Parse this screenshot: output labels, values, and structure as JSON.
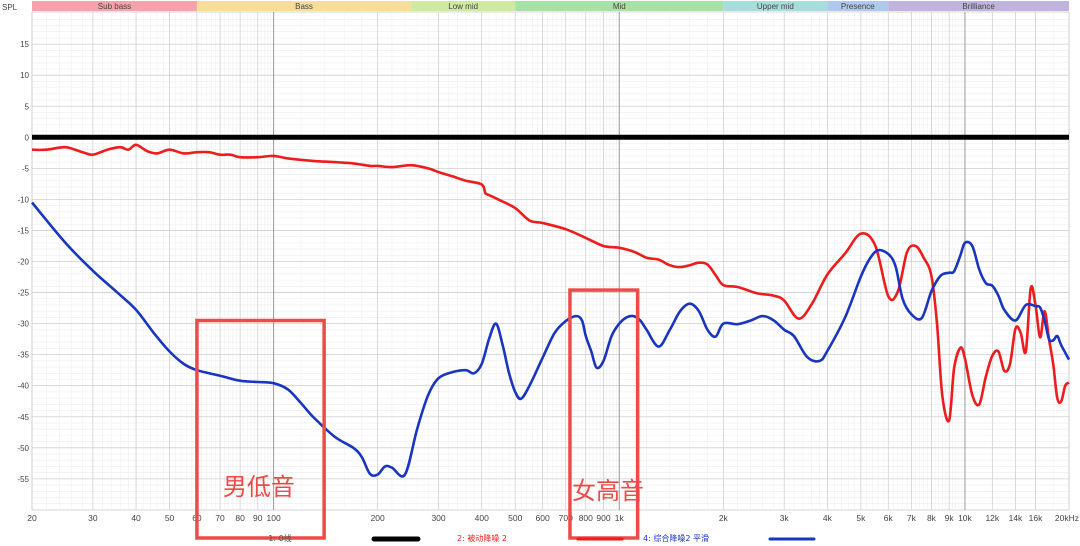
{
  "chart_data": {
    "type": "line",
    "x_scale": "log",
    "x_unit": "Hz",
    "xlim": [
      20,
      20000
    ],
    "ylim": [
      -60,
      20
    ],
    "ylabel": "SPL",
    "grid": true,
    "y_ticks": [
      15,
      10,
      5,
      0,
      -5,
      -10,
      -15,
      -20,
      -25,
      -30,
      -35,
      -40,
      -45,
      -50,
      -55
    ],
    "x_ticks": [
      {
        "v": 20,
        "t": "20"
      },
      {
        "v": 30,
        "t": "30"
      },
      {
        "v": 40,
        "t": "40"
      },
      {
        "v": 50,
        "t": "50"
      },
      {
        "v": 60,
        "t": "60"
      },
      {
        "v": 70,
        "t": "70"
      },
      {
        "v": 80,
        "t": "80"
      },
      {
        "v": 90,
        "t": "90"
      },
      {
        "v": 100,
        "t": "100"
      },
      {
        "v": 200,
        "t": "200"
      },
      {
        "v": 300,
        "t": "300"
      },
      {
        "v": 400,
        "t": "400"
      },
      {
        "v": 500,
        "t": "500"
      },
      {
        "v": 600,
        "t": "600"
      },
      {
        "v": 700,
        "t": "700"
      },
      {
        "v": 800,
        "t": "800"
      },
      {
        "v": 900,
        "t": "900"
      },
      {
        "v": 1000,
        "t": "1k"
      },
      {
        "v": 2000,
        "t": "2k"
      },
      {
        "v": 3000,
        "t": "3k"
      },
      {
        "v": 4000,
        "t": "4k"
      },
      {
        "v": 5000,
        "t": "5k"
      },
      {
        "v": 6000,
        "t": "6k"
      },
      {
        "v": 7000,
        "t": "7k"
      },
      {
        "v": 8000,
        "t": "8k"
      },
      {
        "v": 9000,
        "t": "9k"
      },
      {
        "v": 10000,
        "t": "10k"
      },
      {
        "v": 12000,
        "t": "12k"
      },
      {
        "v": 14000,
        "t": "14k"
      },
      {
        "v": 16000,
        "t": "16k"
      },
      {
        "v": 20000,
        "t": "20kHz"
      }
    ],
    "bands": [
      {
        "name": "Sub bass",
        "from": 20,
        "to": 60,
        "color": "#f5a3ab"
      },
      {
        "name": "Bass",
        "from": 60,
        "to": 250,
        "color": "#f7dc9c"
      },
      {
        "name": "Low mid",
        "from": 250,
        "to": 500,
        "color": "#cdeaa0"
      },
      {
        "name": "Mid",
        "from": 500,
        "to": 2000,
        "color": "#a6e2a6"
      },
      {
        "name": "Upper mid",
        "from": 2000,
        "to": 4000,
        "color": "#a6dede"
      },
      {
        "name": "Presence",
        "from": 4000,
        "to": 6000,
        "color": "#aec8ee"
      },
      {
        "name": "Brilliance",
        "from": 6000,
        "to": 20000,
        "color": "#c0b3dd"
      }
    ],
    "series": [
      {
        "name": "1: 0线",
        "color": "#000000",
        "x": [
          20,
          20000
        ],
        "y": [
          0,
          0
        ]
      },
      {
        "name": "2: 被动降噪 2",
        "color": "#ee1c1c",
        "x": [
          20,
          22,
          25,
          28,
          30,
          33,
          36,
          38,
          40,
          43,
          46,
          50,
          55,
          60,
          65,
          70,
          75,
          80,
          90,
          100,
          110,
          130,
          150,
          170,
          190,
          200,
          220,
          250,
          280,
          300,
          330,
          360,
          400,
          410,
          420,
          450,
          500,
          550,
          600,
          700,
          800,
          900,
          1000,
          1100,
          1200,
          1300,
          1400,
          1500,
          1600,
          1700,
          1800,
          1900,
          2000,
          2200,
          2500,
          2800,
          3000,
          3300,
          3600,
          4000,
          4500,
          5000,
          5500,
          6000,
          6400,
          6800,
          7200,
          7600,
          8000,
          8300,
          8600,
          9000,
          9300,
          9700,
          10000,
          10500,
          11000,
          11500,
          12000,
          12500,
          13000,
          13500,
          14000,
          14500,
          15000,
          15500,
          16000,
          16500,
          17000,
          17500,
          18000,
          18500,
          19000,
          19500,
          20000
        ],
        "y": [
          -2,
          -2,
          -1.6,
          -2.4,
          -2.8,
          -2,
          -1.6,
          -2,
          -1.2,
          -2.2,
          -2.6,
          -2.0,
          -2.6,
          -2.4,
          -2.4,
          -2.8,
          -2.8,
          -3.2,
          -3.2,
          -3.0,
          -3.4,
          -3.8,
          -4.0,
          -4.2,
          -4.6,
          -4.6,
          -4.8,
          -4.5,
          -5.0,
          -5.6,
          -6.3,
          -7.0,
          -7.6,
          -9.0,
          -9.3,
          -10.1,
          -11.4,
          -13.4,
          -13.8,
          -14.8,
          -16.2,
          -17.5,
          -17.8,
          -18.4,
          -19.4,
          -19.7,
          -20.6,
          -20.9,
          -20.6,
          -20.2,
          -20.5,
          -22.2,
          -23.8,
          -24.1,
          -25.1,
          -25.5,
          -26.3,
          -29.2,
          -26.9,
          -22.1,
          -18.7,
          -15.5,
          -17.4,
          -25.6,
          -24.8,
          -18.5,
          -17.5,
          -19.4,
          -22.3,
          -30.0,
          -41.6,
          -45.6,
          -37.3,
          -33.9,
          -35.6,
          -41.5,
          -43.0,
          -38.5,
          -35.2,
          -34.5,
          -37.6,
          -36.5,
          -30.8,
          -31.5,
          -34.5,
          -24.3,
          -27.0,
          -32.2,
          -28.0,
          -32.5,
          -36.5,
          -42.0,
          -42.5,
          -40.0,
          -39.5
        ]
      },
      {
        "name": "4: 综合降噪2 平滑",
        "color": "#1a35c0",
        "x": [
          20,
          25,
          30,
          35,
          40,
          45,
          50,
          55,
          60,
          70,
          80,
          90,
          100,
          110,
          120,
          130,
          150,
          170,
          180,
          190,
          200,
          210,
          220,
          240,
          260,
          280,
          300,
          330,
          360,
          380,
          400,
          420,
          440,
          460,
          480,
          500,
          520,
          550,
          600,
          650,
          700,
          750,
          780,
          800,
          830,
          860,
          900,
          950,
          1000,
          1050,
          1100,
          1150,
          1200,
          1300,
          1400,
          1500,
          1600,
          1700,
          1800,
          1900,
          2000,
          2200,
          2400,
          2600,
          2800,
          3000,
          3200,
          3500,
          3800,
          4000,
          4500,
          5000,
          5300,
          5600,
          6000,
          6300,
          6600,
          7000,
          7500,
          8000,
          8500,
          9000,
          9300,
          9700,
          10000,
          10500,
          11000,
          11500,
          12000,
          12500,
          13000,
          14000,
          15000,
          16000,
          16500,
          17000,
          17500,
          18000,
          18500,
          19000,
          20000
        ],
        "y": [
          -10.5,
          -17.0,
          -21.5,
          -24.8,
          -27.8,
          -31.5,
          -34.5,
          -36.5,
          -37.5,
          -38.4,
          -39.2,
          -39.4,
          -39.6,
          -40.6,
          -42.8,
          -45.0,
          -48.2,
          -50.0,
          -51.5,
          -54.2,
          -54.3,
          -53.0,
          -53.2,
          -54.3,
          -47.0,
          -41.5,
          -38.8,
          -37.8,
          -37.5,
          -38.0,
          -36.5,
          -32.5,
          -30.0,
          -33.5,
          -38.0,
          -41.0,
          -42.1,
          -40.0,
          -35.5,
          -31.5,
          -29.6,
          -28.8,
          -29.5,
          -32.0,
          -34.5,
          -37.1,
          -36.0,
          -32.0,
          -30.0,
          -29.0,
          -28.8,
          -29.5,
          -31.0,
          -33.7,
          -31.0,
          -28.0,
          -26.8,
          -28.0,
          -31.0,
          -32.1,
          -30.0,
          -30.1,
          -29.5,
          -28.8,
          -29.5,
          -31.0,
          -32.0,
          -35.4,
          -36.0,
          -34.4,
          -29.0,
          -22.4,
          -19.6,
          -18.2,
          -18.8,
          -20.8,
          -26.0,
          -28.5,
          -29.1,
          -24.8,
          -22.3,
          -21.8,
          -21.6,
          -19.0,
          -17.0,
          -17.5,
          -21.3,
          -23.5,
          -23.9,
          -25.5,
          -27.8,
          -29.5,
          -27.0,
          -27.2,
          -27.4,
          -29.5,
          -32.5,
          -32.7,
          -32.0,
          -33.5,
          -35.8
        ]
      }
    ],
    "legend": [
      {
        "label": "1: 0线",
        "color": "#000000"
      },
      {
        "label": "2: 被动降噪 2",
        "color": "#ee1c1c"
      },
      {
        "label": "4: 综合降噪2 平滑",
        "color": "#1a35c0"
      }
    ],
    "annotations": [
      {
        "label": "男低音",
        "x_from": 60,
        "x_to": 140,
        "y_from": -29.5,
        "y_to": -66,
        "color": "#ee4a4a"
      },
      {
        "label": "女高音",
        "x_from": 720,
        "x_to": 1130,
        "y_from": -24.6,
        "y_to": -66,
        "color": "#ee4a4a"
      }
    ]
  }
}
